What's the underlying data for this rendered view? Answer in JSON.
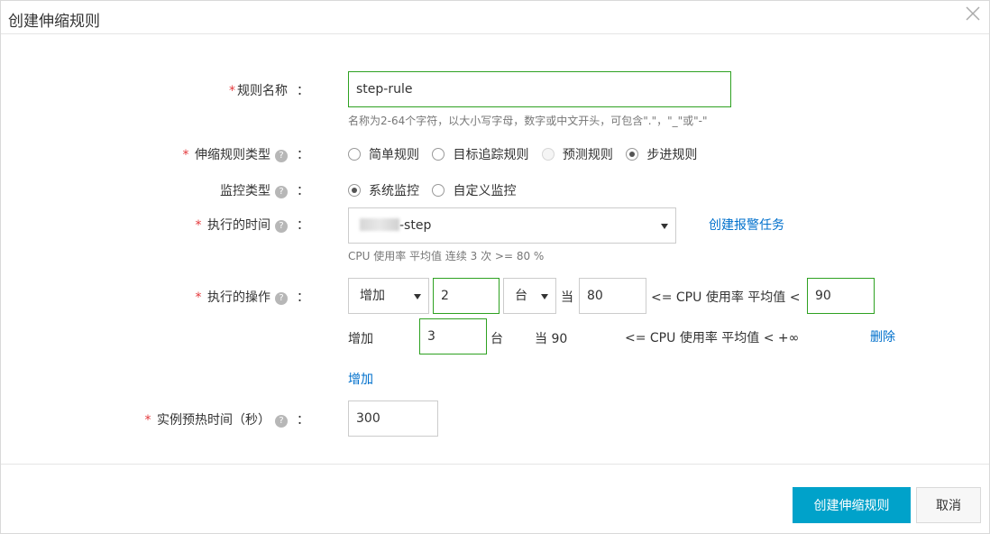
{
  "dialog": {
    "title": "创建伸缩规则",
    "close_icon": "close-icon"
  },
  "form": {
    "rule_name": {
      "required_mark": "*",
      "label": "规则名称",
      "colon": "：",
      "value": "step-rule",
      "hint": "名称为2-64个字符，以大小写字母，数字或中文开头，可包含\".\"，\"_\"或\"-\""
    },
    "rule_type": {
      "required_mark": "*",
      "label": "伸缩规则类型",
      "colon": "：",
      "help": "?",
      "options": [
        {
          "label": "简单规则",
          "state": "unchecked"
        },
        {
          "label": "目标追踪规则",
          "state": "unchecked"
        },
        {
          "label": "预测规则",
          "state": "disabled"
        },
        {
          "label": "步进规则",
          "state": "checked"
        }
      ]
    },
    "monitor_type": {
      "label": "监控类型",
      "colon": "：",
      "help": "?",
      "options": [
        {
          "label": "系统监控",
          "state": "checked"
        },
        {
          "label": "自定义监控",
          "state": "unchecked"
        }
      ]
    },
    "exec_time": {
      "required_mark": "*",
      "label": "执行的时间",
      "colon": "：",
      "help": "?",
      "selected_suffix": "-step",
      "create_alarm_link": "创建报警任务",
      "condition_text": "CPU 使用率  平均值  连续 3  次 >=  80 %"
    },
    "exec_action": {
      "required_mark": "*",
      "label": "执行的操作",
      "colon": "：",
      "help": "?",
      "row1": {
        "action": "增加",
        "count": "2",
        "unit": "台",
        "when_label": "当",
        "lower": "80",
        "metric_text": "<= CPU 使用率 平均值 <",
        "upper": "90"
      },
      "row2": {
        "action": "增加",
        "count": "3",
        "unit": "台",
        "when_text": "当 90",
        "metric_text": "<= CPU 使用率 平均值 < +∞",
        "delete_link": "删除"
      },
      "add_link": "增加"
    },
    "warmup": {
      "required_mark": "*",
      "label": "实例预热时间（秒）",
      "colon": "：",
      "help": "?",
      "value": "300"
    }
  },
  "footer": {
    "submit_label": "创建伸缩规则",
    "cancel_label": "取消"
  },
  "colors": {
    "primary": "#00a2ca",
    "link": "#0070cc",
    "required": "#e4393c",
    "active_border": "#2ea121"
  }
}
